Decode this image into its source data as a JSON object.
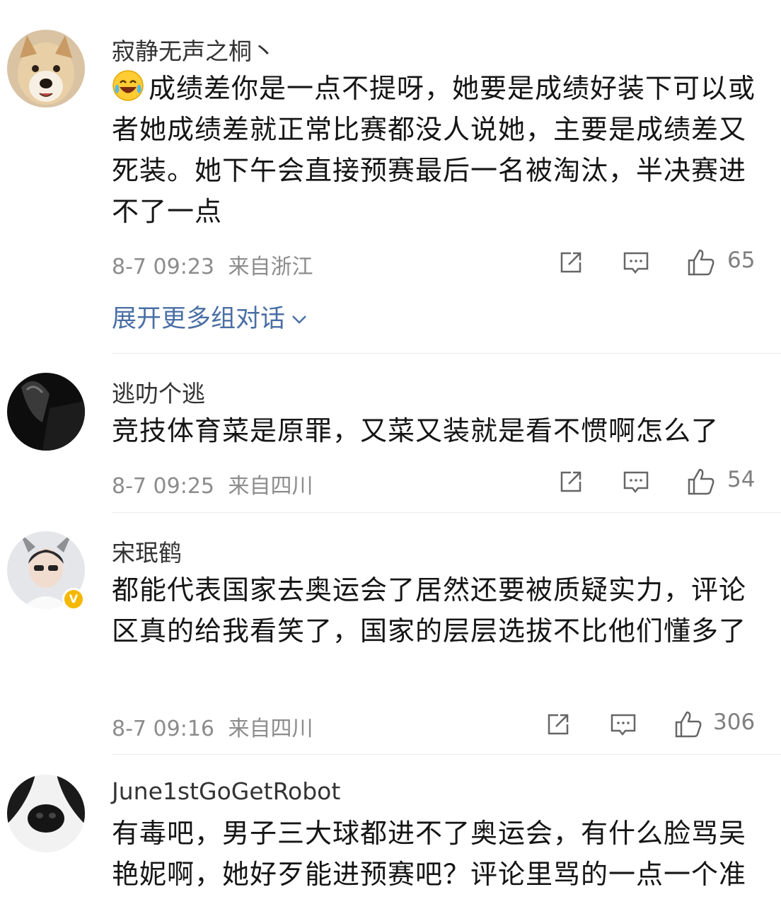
{
  "comments": [
    {
      "username": "寂静无声之桐丶",
      "text": "成绩差你是一点不提呀，她要是成绩好装下可以或者她成绩差就正常比赛都没人说她，主要是成绩差又死装。她下午会直接预赛最后一名被淘汰，半决赛进不了一点",
      "leading_emoji": "laugh-cry-emoji",
      "time": "8-7 09:23",
      "location": "来自浙江",
      "likes": "65",
      "expand_label": "展开更多组对话"
    },
    {
      "username": "逃叻个逃",
      "text": "竞技体育菜是原罪，又菜又装就是看不惯啊怎么了",
      "time": "8-7 09:25",
      "location": "来自四川",
      "likes": "54"
    },
    {
      "username": "宋珉鹤",
      "text": "都能代表国家去奥运会了居然还要被质疑实力，评论区真的给我看笑了，国家的层层选拔不比他们懂多了",
      "verified": true,
      "verified_badge": "V",
      "time": "8-7 09:16",
      "location": "来自四川",
      "likes": "306"
    },
    {
      "username": "June1stGoGetRobot",
      "text": "有毒吧，男子三大球都进不了奥运会，有什么脸骂吴艳妮啊，她好歹能进预赛吧？评论里骂的一点一个准"
    }
  ],
  "icons": {
    "share": "share-icon",
    "comment": "comment-icon",
    "like": "thumbs-up-icon",
    "expand": "chevron-down-icon"
  },
  "colors": {
    "link": "#4a6fa5",
    "meta": "#8c8c8c",
    "text": "#151515",
    "verified": "#f5b800"
  }
}
